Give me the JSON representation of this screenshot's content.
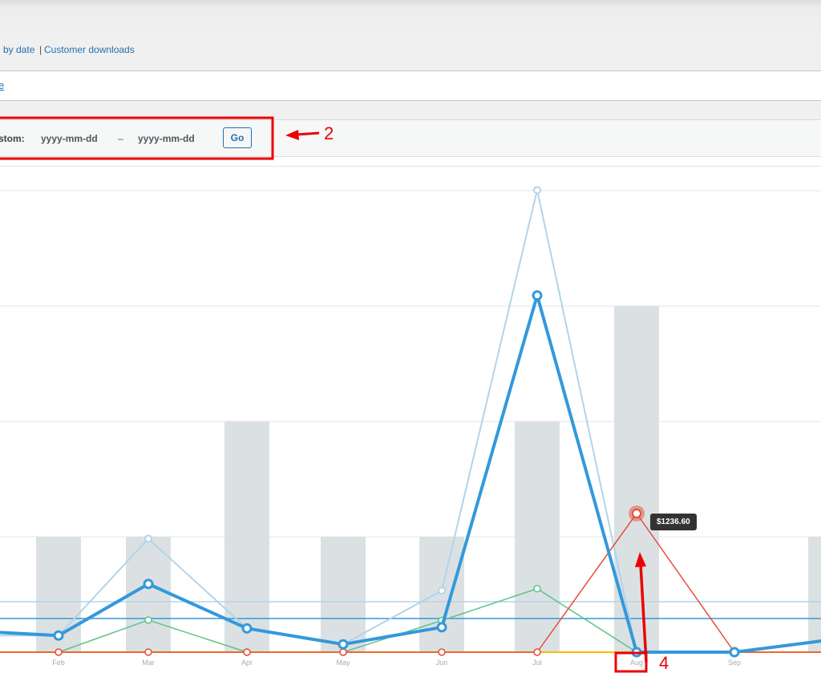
{
  "subnav": {
    "by_date": "by date",
    "separator": "|",
    "customer_downloads": "Customer downloads"
  },
  "linkrow": {
    "link": "e"
  },
  "date_range": {
    "custom_label": "stom:",
    "start_placeholder": "yyyy-mm-dd",
    "dash": "–",
    "end_placeholder": "yyyy-mm-dd",
    "go_label": "Go"
  },
  "tooltip": {
    "value": "$1236.60"
  },
  "annotations": {
    "two": "2",
    "four": "4"
  },
  "colors": {
    "gross_sales": "#3498db",
    "net_sales": "#b1d4ea",
    "coupons": "#5cc488",
    "refunds": "#e74c3c",
    "shipping": "#ffba00",
    "orders_bars": "#dbe1e3",
    "annotation": "#ee0000"
  },
  "chart_data": {
    "type": "line",
    "categories": [
      "Feb",
      "Mar",
      "Apr",
      "May",
      "Jun",
      "Jul",
      "Aug",
      "Sep"
    ],
    "bars_orders": [
      1,
      1,
      2,
      1,
      1,
      2,
      3,
      0
    ],
    "series": [
      {
        "key": "gross_sales",
        "values": [
          148,
          608,
          212,
          70,
          222,
          3180,
          0,
          0
        ]
      },
      {
        "key": "net_sales",
        "values": [
          148,
          1012,
          212,
          70,
          548,
          4120,
          0,
          0
        ]
      },
      {
        "key": "coupons",
        "values": [
          0,
          286,
          0,
          0,
          282,
          566,
          0,
          0
        ]
      },
      {
        "key": "refunds",
        "values": [
          0,
          0,
          0,
          0,
          0,
          0,
          1236.6,
          0
        ]
      },
      {
        "key": "shipping",
        "values": [
          0,
          0,
          0,
          0,
          0,
          0,
          0,
          0
        ]
      }
    ],
    "average_lines": [
      450,
      300
    ]
  }
}
